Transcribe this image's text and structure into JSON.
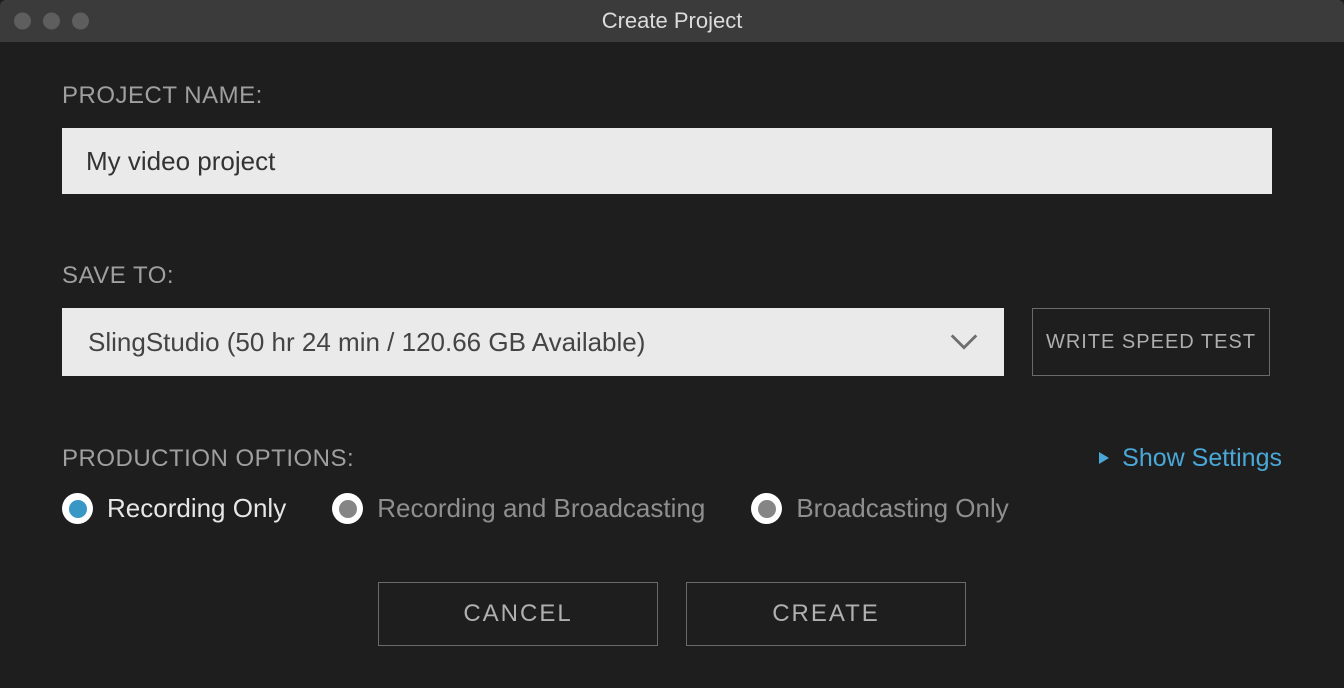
{
  "window": {
    "title": "Create Project"
  },
  "project_name": {
    "label": "PROJECT NAME:",
    "value": "My video project"
  },
  "save_to": {
    "label": "SAVE TO:",
    "selected": "SlingStudio (50 hr 24 min / 120.66 GB Available)",
    "write_speed_test": "WRITE SPEED TEST"
  },
  "production_options": {
    "label": "PRODUCTION OPTIONS:",
    "show_settings": "Show Settings",
    "options": [
      {
        "label": "Recording Only",
        "selected": true
      },
      {
        "label": "Recording and Broadcasting",
        "selected": false
      },
      {
        "label": "Broadcasting Only",
        "selected": false
      }
    ]
  },
  "footer": {
    "cancel": "CANCEL",
    "create": "CREATE"
  }
}
